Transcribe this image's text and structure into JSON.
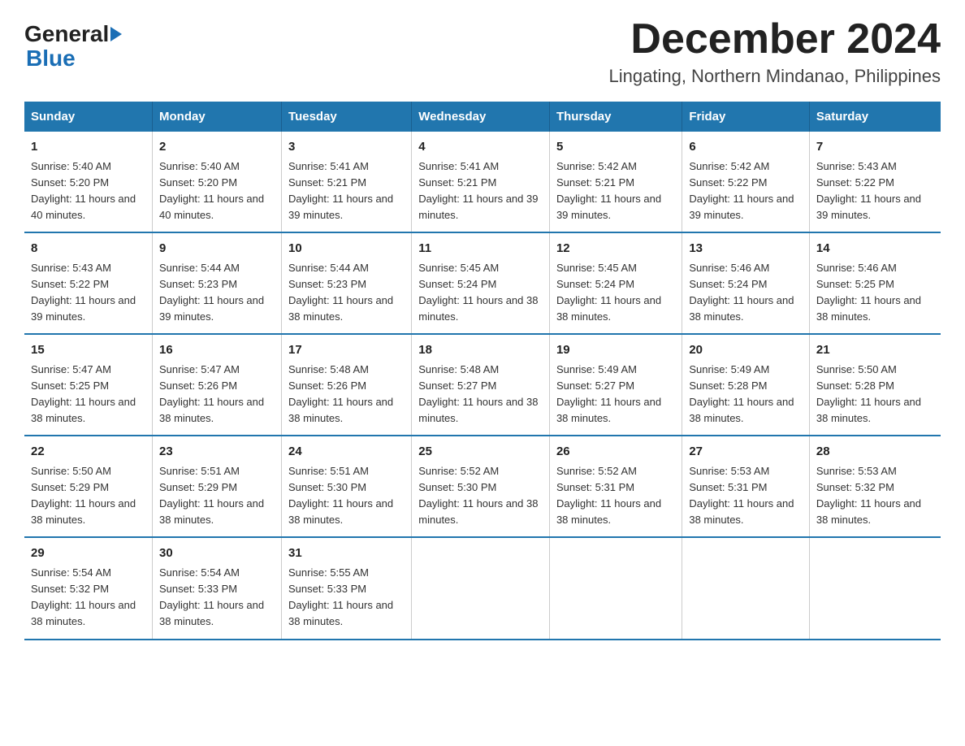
{
  "logo": {
    "general": "General",
    "blue": "Blue"
  },
  "title": "December 2024",
  "subtitle": "Lingating, Northern Mindanao, Philippines",
  "weekdays": [
    "Sunday",
    "Monday",
    "Tuesday",
    "Wednesday",
    "Thursday",
    "Friday",
    "Saturday"
  ],
  "weeks": [
    [
      {
        "day": "1",
        "sunrise": "Sunrise: 5:40 AM",
        "sunset": "Sunset: 5:20 PM",
        "daylight": "Daylight: 11 hours and 40 minutes."
      },
      {
        "day": "2",
        "sunrise": "Sunrise: 5:40 AM",
        "sunset": "Sunset: 5:20 PM",
        "daylight": "Daylight: 11 hours and 40 minutes."
      },
      {
        "day": "3",
        "sunrise": "Sunrise: 5:41 AM",
        "sunset": "Sunset: 5:21 PM",
        "daylight": "Daylight: 11 hours and 39 minutes."
      },
      {
        "day": "4",
        "sunrise": "Sunrise: 5:41 AM",
        "sunset": "Sunset: 5:21 PM",
        "daylight": "Daylight: 11 hours and 39 minutes."
      },
      {
        "day": "5",
        "sunrise": "Sunrise: 5:42 AM",
        "sunset": "Sunset: 5:21 PM",
        "daylight": "Daylight: 11 hours and 39 minutes."
      },
      {
        "day": "6",
        "sunrise": "Sunrise: 5:42 AM",
        "sunset": "Sunset: 5:22 PM",
        "daylight": "Daylight: 11 hours and 39 minutes."
      },
      {
        "day": "7",
        "sunrise": "Sunrise: 5:43 AM",
        "sunset": "Sunset: 5:22 PM",
        "daylight": "Daylight: 11 hours and 39 minutes."
      }
    ],
    [
      {
        "day": "8",
        "sunrise": "Sunrise: 5:43 AM",
        "sunset": "Sunset: 5:22 PM",
        "daylight": "Daylight: 11 hours and 39 minutes."
      },
      {
        "day": "9",
        "sunrise": "Sunrise: 5:44 AM",
        "sunset": "Sunset: 5:23 PM",
        "daylight": "Daylight: 11 hours and 39 minutes."
      },
      {
        "day": "10",
        "sunrise": "Sunrise: 5:44 AM",
        "sunset": "Sunset: 5:23 PM",
        "daylight": "Daylight: 11 hours and 38 minutes."
      },
      {
        "day": "11",
        "sunrise": "Sunrise: 5:45 AM",
        "sunset": "Sunset: 5:24 PM",
        "daylight": "Daylight: 11 hours and 38 minutes."
      },
      {
        "day": "12",
        "sunrise": "Sunrise: 5:45 AM",
        "sunset": "Sunset: 5:24 PM",
        "daylight": "Daylight: 11 hours and 38 minutes."
      },
      {
        "day": "13",
        "sunrise": "Sunrise: 5:46 AM",
        "sunset": "Sunset: 5:24 PM",
        "daylight": "Daylight: 11 hours and 38 minutes."
      },
      {
        "day": "14",
        "sunrise": "Sunrise: 5:46 AM",
        "sunset": "Sunset: 5:25 PM",
        "daylight": "Daylight: 11 hours and 38 minutes."
      }
    ],
    [
      {
        "day": "15",
        "sunrise": "Sunrise: 5:47 AM",
        "sunset": "Sunset: 5:25 PM",
        "daylight": "Daylight: 11 hours and 38 minutes."
      },
      {
        "day": "16",
        "sunrise": "Sunrise: 5:47 AM",
        "sunset": "Sunset: 5:26 PM",
        "daylight": "Daylight: 11 hours and 38 minutes."
      },
      {
        "day": "17",
        "sunrise": "Sunrise: 5:48 AM",
        "sunset": "Sunset: 5:26 PM",
        "daylight": "Daylight: 11 hours and 38 minutes."
      },
      {
        "day": "18",
        "sunrise": "Sunrise: 5:48 AM",
        "sunset": "Sunset: 5:27 PM",
        "daylight": "Daylight: 11 hours and 38 minutes."
      },
      {
        "day": "19",
        "sunrise": "Sunrise: 5:49 AM",
        "sunset": "Sunset: 5:27 PM",
        "daylight": "Daylight: 11 hours and 38 minutes."
      },
      {
        "day": "20",
        "sunrise": "Sunrise: 5:49 AM",
        "sunset": "Sunset: 5:28 PM",
        "daylight": "Daylight: 11 hours and 38 minutes."
      },
      {
        "day": "21",
        "sunrise": "Sunrise: 5:50 AM",
        "sunset": "Sunset: 5:28 PM",
        "daylight": "Daylight: 11 hours and 38 minutes."
      }
    ],
    [
      {
        "day": "22",
        "sunrise": "Sunrise: 5:50 AM",
        "sunset": "Sunset: 5:29 PM",
        "daylight": "Daylight: 11 hours and 38 minutes."
      },
      {
        "day": "23",
        "sunrise": "Sunrise: 5:51 AM",
        "sunset": "Sunset: 5:29 PM",
        "daylight": "Daylight: 11 hours and 38 minutes."
      },
      {
        "day": "24",
        "sunrise": "Sunrise: 5:51 AM",
        "sunset": "Sunset: 5:30 PM",
        "daylight": "Daylight: 11 hours and 38 minutes."
      },
      {
        "day": "25",
        "sunrise": "Sunrise: 5:52 AM",
        "sunset": "Sunset: 5:30 PM",
        "daylight": "Daylight: 11 hours and 38 minutes."
      },
      {
        "day": "26",
        "sunrise": "Sunrise: 5:52 AM",
        "sunset": "Sunset: 5:31 PM",
        "daylight": "Daylight: 11 hours and 38 minutes."
      },
      {
        "day": "27",
        "sunrise": "Sunrise: 5:53 AM",
        "sunset": "Sunset: 5:31 PM",
        "daylight": "Daylight: 11 hours and 38 minutes."
      },
      {
        "day": "28",
        "sunrise": "Sunrise: 5:53 AM",
        "sunset": "Sunset: 5:32 PM",
        "daylight": "Daylight: 11 hours and 38 minutes."
      }
    ],
    [
      {
        "day": "29",
        "sunrise": "Sunrise: 5:54 AM",
        "sunset": "Sunset: 5:32 PM",
        "daylight": "Daylight: 11 hours and 38 minutes."
      },
      {
        "day": "30",
        "sunrise": "Sunrise: 5:54 AM",
        "sunset": "Sunset: 5:33 PM",
        "daylight": "Daylight: 11 hours and 38 minutes."
      },
      {
        "day": "31",
        "sunrise": "Sunrise: 5:55 AM",
        "sunset": "Sunset: 5:33 PM",
        "daylight": "Daylight: 11 hours and 38 minutes."
      },
      {
        "day": "",
        "sunrise": "",
        "sunset": "",
        "daylight": ""
      },
      {
        "day": "",
        "sunrise": "",
        "sunset": "",
        "daylight": ""
      },
      {
        "day": "",
        "sunrise": "",
        "sunset": "",
        "daylight": ""
      },
      {
        "day": "",
        "sunrise": "",
        "sunset": "",
        "daylight": ""
      }
    ]
  ]
}
